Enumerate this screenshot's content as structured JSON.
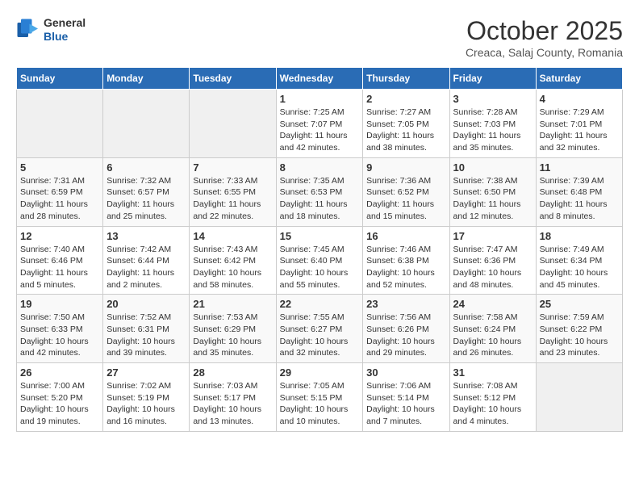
{
  "header": {
    "logo_general": "General",
    "logo_blue": "Blue",
    "month_title": "October 2025",
    "location": "Creaca, Salaj County, Romania"
  },
  "days_of_week": [
    "Sunday",
    "Monday",
    "Tuesday",
    "Wednesday",
    "Thursday",
    "Friday",
    "Saturday"
  ],
  "weeks": [
    [
      {
        "day": "",
        "content": ""
      },
      {
        "day": "",
        "content": ""
      },
      {
        "day": "",
        "content": ""
      },
      {
        "day": "1",
        "content": "Sunrise: 7:25 AM\nSunset: 7:07 PM\nDaylight: 11 hours\nand 42 minutes."
      },
      {
        "day": "2",
        "content": "Sunrise: 7:27 AM\nSunset: 7:05 PM\nDaylight: 11 hours\nand 38 minutes."
      },
      {
        "day": "3",
        "content": "Sunrise: 7:28 AM\nSunset: 7:03 PM\nDaylight: 11 hours\nand 35 minutes."
      },
      {
        "day": "4",
        "content": "Sunrise: 7:29 AM\nSunset: 7:01 PM\nDaylight: 11 hours\nand 32 minutes."
      }
    ],
    [
      {
        "day": "5",
        "content": "Sunrise: 7:31 AM\nSunset: 6:59 PM\nDaylight: 11 hours\nand 28 minutes."
      },
      {
        "day": "6",
        "content": "Sunrise: 7:32 AM\nSunset: 6:57 PM\nDaylight: 11 hours\nand 25 minutes."
      },
      {
        "day": "7",
        "content": "Sunrise: 7:33 AM\nSunset: 6:55 PM\nDaylight: 11 hours\nand 22 minutes."
      },
      {
        "day": "8",
        "content": "Sunrise: 7:35 AM\nSunset: 6:53 PM\nDaylight: 11 hours\nand 18 minutes."
      },
      {
        "day": "9",
        "content": "Sunrise: 7:36 AM\nSunset: 6:52 PM\nDaylight: 11 hours\nand 15 minutes."
      },
      {
        "day": "10",
        "content": "Sunrise: 7:38 AM\nSunset: 6:50 PM\nDaylight: 11 hours\nand 12 minutes."
      },
      {
        "day": "11",
        "content": "Sunrise: 7:39 AM\nSunset: 6:48 PM\nDaylight: 11 hours\nand 8 minutes."
      }
    ],
    [
      {
        "day": "12",
        "content": "Sunrise: 7:40 AM\nSunset: 6:46 PM\nDaylight: 11 hours\nand 5 minutes."
      },
      {
        "day": "13",
        "content": "Sunrise: 7:42 AM\nSunset: 6:44 PM\nDaylight: 11 hours\nand 2 minutes."
      },
      {
        "day": "14",
        "content": "Sunrise: 7:43 AM\nSunset: 6:42 PM\nDaylight: 10 hours\nand 58 minutes."
      },
      {
        "day": "15",
        "content": "Sunrise: 7:45 AM\nSunset: 6:40 PM\nDaylight: 10 hours\nand 55 minutes."
      },
      {
        "day": "16",
        "content": "Sunrise: 7:46 AM\nSunset: 6:38 PM\nDaylight: 10 hours\nand 52 minutes."
      },
      {
        "day": "17",
        "content": "Sunrise: 7:47 AM\nSunset: 6:36 PM\nDaylight: 10 hours\nand 48 minutes."
      },
      {
        "day": "18",
        "content": "Sunrise: 7:49 AM\nSunset: 6:34 PM\nDaylight: 10 hours\nand 45 minutes."
      }
    ],
    [
      {
        "day": "19",
        "content": "Sunrise: 7:50 AM\nSunset: 6:33 PM\nDaylight: 10 hours\nand 42 minutes."
      },
      {
        "day": "20",
        "content": "Sunrise: 7:52 AM\nSunset: 6:31 PM\nDaylight: 10 hours\nand 39 minutes."
      },
      {
        "day": "21",
        "content": "Sunrise: 7:53 AM\nSunset: 6:29 PM\nDaylight: 10 hours\nand 35 minutes."
      },
      {
        "day": "22",
        "content": "Sunrise: 7:55 AM\nSunset: 6:27 PM\nDaylight: 10 hours\nand 32 minutes."
      },
      {
        "day": "23",
        "content": "Sunrise: 7:56 AM\nSunset: 6:26 PM\nDaylight: 10 hours\nand 29 minutes."
      },
      {
        "day": "24",
        "content": "Sunrise: 7:58 AM\nSunset: 6:24 PM\nDaylight: 10 hours\nand 26 minutes."
      },
      {
        "day": "25",
        "content": "Sunrise: 7:59 AM\nSunset: 6:22 PM\nDaylight: 10 hours\nand 23 minutes."
      }
    ],
    [
      {
        "day": "26",
        "content": "Sunrise: 7:00 AM\nSunset: 5:20 PM\nDaylight: 10 hours\nand 19 minutes."
      },
      {
        "day": "27",
        "content": "Sunrise: 7:02 AM\nSunset: 5:19 PM\nDaylight: 10 hours\nand 16 minutes."
      },
      {
        "day": "28",
        "content": "Sunrise: 7:03 AM\nSunset: 5:17 PM\nDaylight: 10 hours\nand 13 minutes."
      },
      {
        "day": "29",
        "content": "Sunrise: 7:05 AM\nSunset: 5:15 PM\nDaylight: 10 hours\nand 10 minutes."
      },
      {
        "day": "30",
        "content": "Sunrise: 7:06 AM\nSunset: 5:14 PM\nDaylight: 10 hours\nand 7 minutes."
      },
      {
        "day": "31",
        "content": "Sunrise: 7:08 AM\nSunset: 5:12 PM\nDaylight: 10 hours\nand 4 minutes."
      },
      {
        "day": "",
        "content": ""
      }
    ]
  ]
}
